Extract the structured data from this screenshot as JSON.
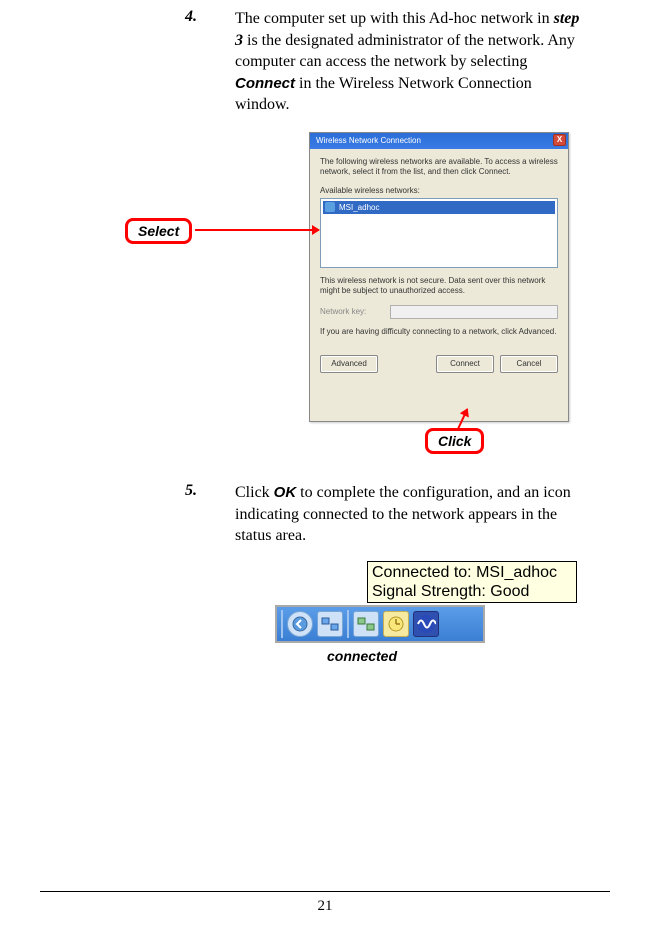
{
  "step4": {
    "num": "4.",
    "t1": "The computer set up with this Ad-hoc network in ",
    "t2": "step 3",
    "t3": " is the designated administrator of the network. Any computer can access the network by selecting ",
    "t4": "Connect",
    "t5": " in the Wireless Network Connection window."
  },
  "step5": {
    "num": "5.",
    "t1": "Click ",
    "t2": "OK",
    "t3": " to complete the configuration, and an icon indicating connected to the network appears in the status area."
  },
  "dlg": {
    "title": "Wireless Network Connection",
    "intro": "The following wireless networks are available. To access a wireless network, select it from the list, and then click Connect.",
    "avail": "Available wireless networks:",
    "entry": "MSI_adhoc",
    "warn": "This wireless network is not secure. Data sent over this network might be subject to unauthorized access.",
    "keylabel": "Network key:",
    "help": "If you are having difficulty connecting to a network, click Advanced.",
    "btn_adv": "Advanced",
    "btn_connect": "Connect",
    "btn_cancel": "Cancel",
    "close": "X"
  },
  "callout": {
    "select": "Select",
    "click": "Click"
  },
  "tooltip": {
    "line1": "Connected to: MSI_adhoc",
    "line2": "Signal Strength: Good"
  },
  "connected_label": "connected",
  "page": "21"
}
